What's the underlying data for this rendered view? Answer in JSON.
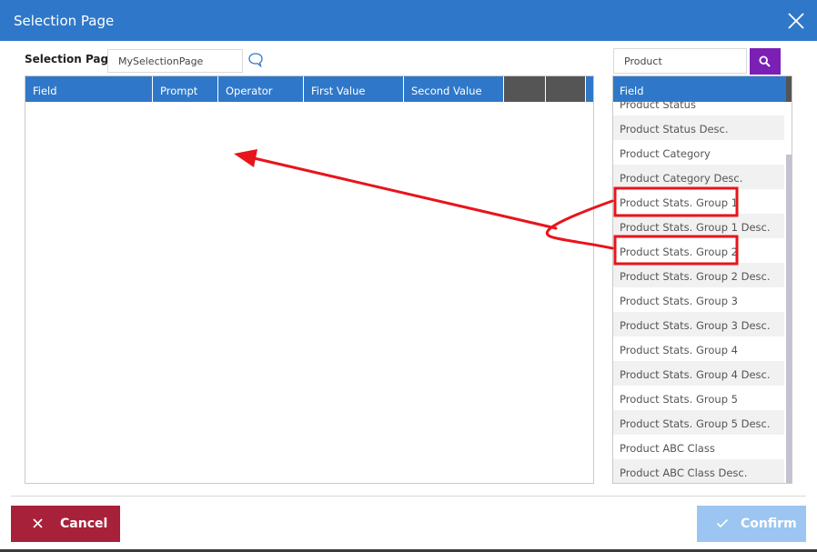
{
  "window": {
    "title": "Selection Page",
    "close_icon": "close-icon"
  },
  "selection": {
    "label": "Selection Page:",
    "value": "MySelectionPage",
    "chat_icon": "chat-bubble-icon"
  },
  "grid": {
    "columns": [
      "Field",
      "Prompt",
      "Operator",
      "First Value",
      "Second Value",
      "",
      ""
    ]
  },
  "search": {
    "value": "Product",
    "button_icon": "search-icon"
  },
  "field_panel": {
    "header": "Field",
    "items": [
      "Product Status",
      "Product Status Desc.",
      "Product Category",
      "Product Category Desc.",
      "Product Stats. Group 1",
      "Product Stats. Group 1 Desc.",
      "Product Stats. Group 2",
      "Product Stats. Group 2 Desc.",
      "Product Stats. Group 3",
      "Product Stats. Group 3 Desc.",
      "Product Stats. Group 4",
      "Product Stats. Group 4 Desc.",
      "Product Stats. Group 5",
      "Product Stats. Group 5 Desc.",
      "Product ABC Class",
      "Product ABC Class Desc."
    ],
    "highlighted": [
      "Product Stats. Group 1",
      "Product Stats. Group 2"
    ]
  },
  "annotation": {
    "color": "#e8141c"
  },
  "footer": {
    "cancel_label": "Cancel",
    "confirm_label": "Confirm"
  },
  "colors": {
    "header_blue": "#2f78c9",
    "search_purple": "#7b1fb5",
    "cancel_red": "#a8213a",
    "confirm_disabled": "#9cc5f1"
  }
}
